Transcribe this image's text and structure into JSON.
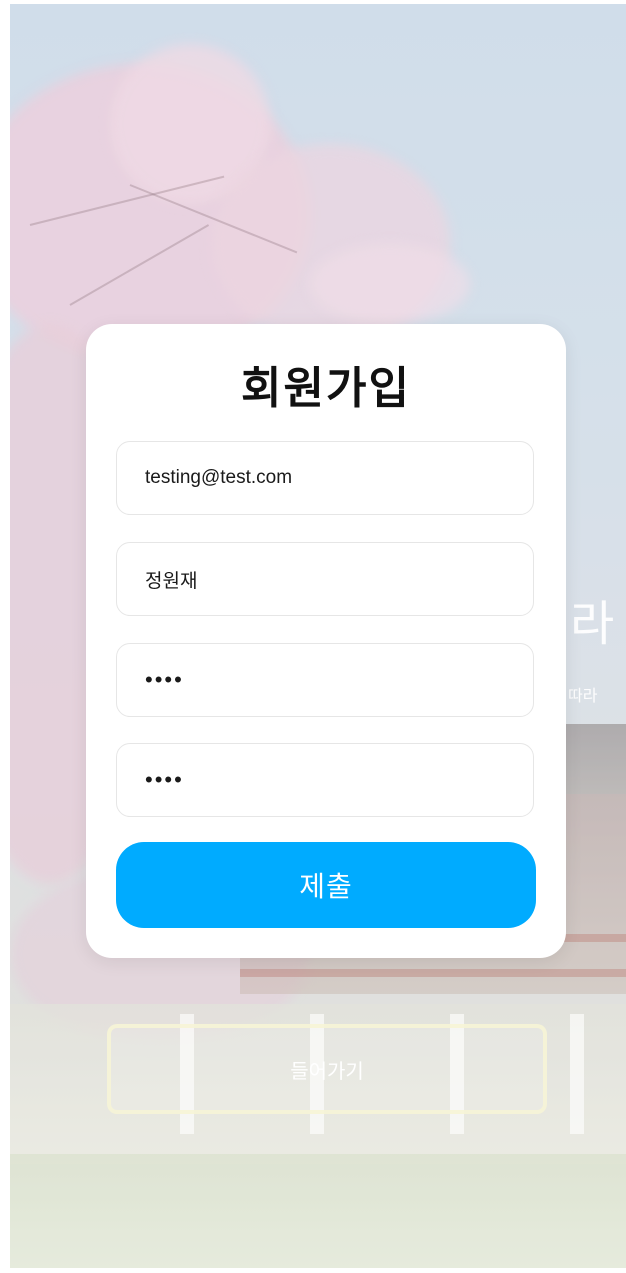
{
  "background": {
    "headline_fragment": "라",
    "subtitle_fragment": "따라"
  },
  "signup": {
    "title": "회원가입",
    "email": {
      "value": "testing@test.com",
      "placeholder": ""
    },
    "name": {
      "value": "정원재",
      "placeholder": ""
    },
    "password": {
      "value": "1234",
      "placeholder": ""
    },
    "password_confirm": {
      "value": "1234",
      "placeholder": ""
    },
    "submit_label": "제출"
  },
  "enter_button": {
    "label": "들어가기"
  },
  "colors": {
    "accent": "#00abff",
    "card": "#ffffff",
    "enter_border": "#f6f4d6"
  }
}
